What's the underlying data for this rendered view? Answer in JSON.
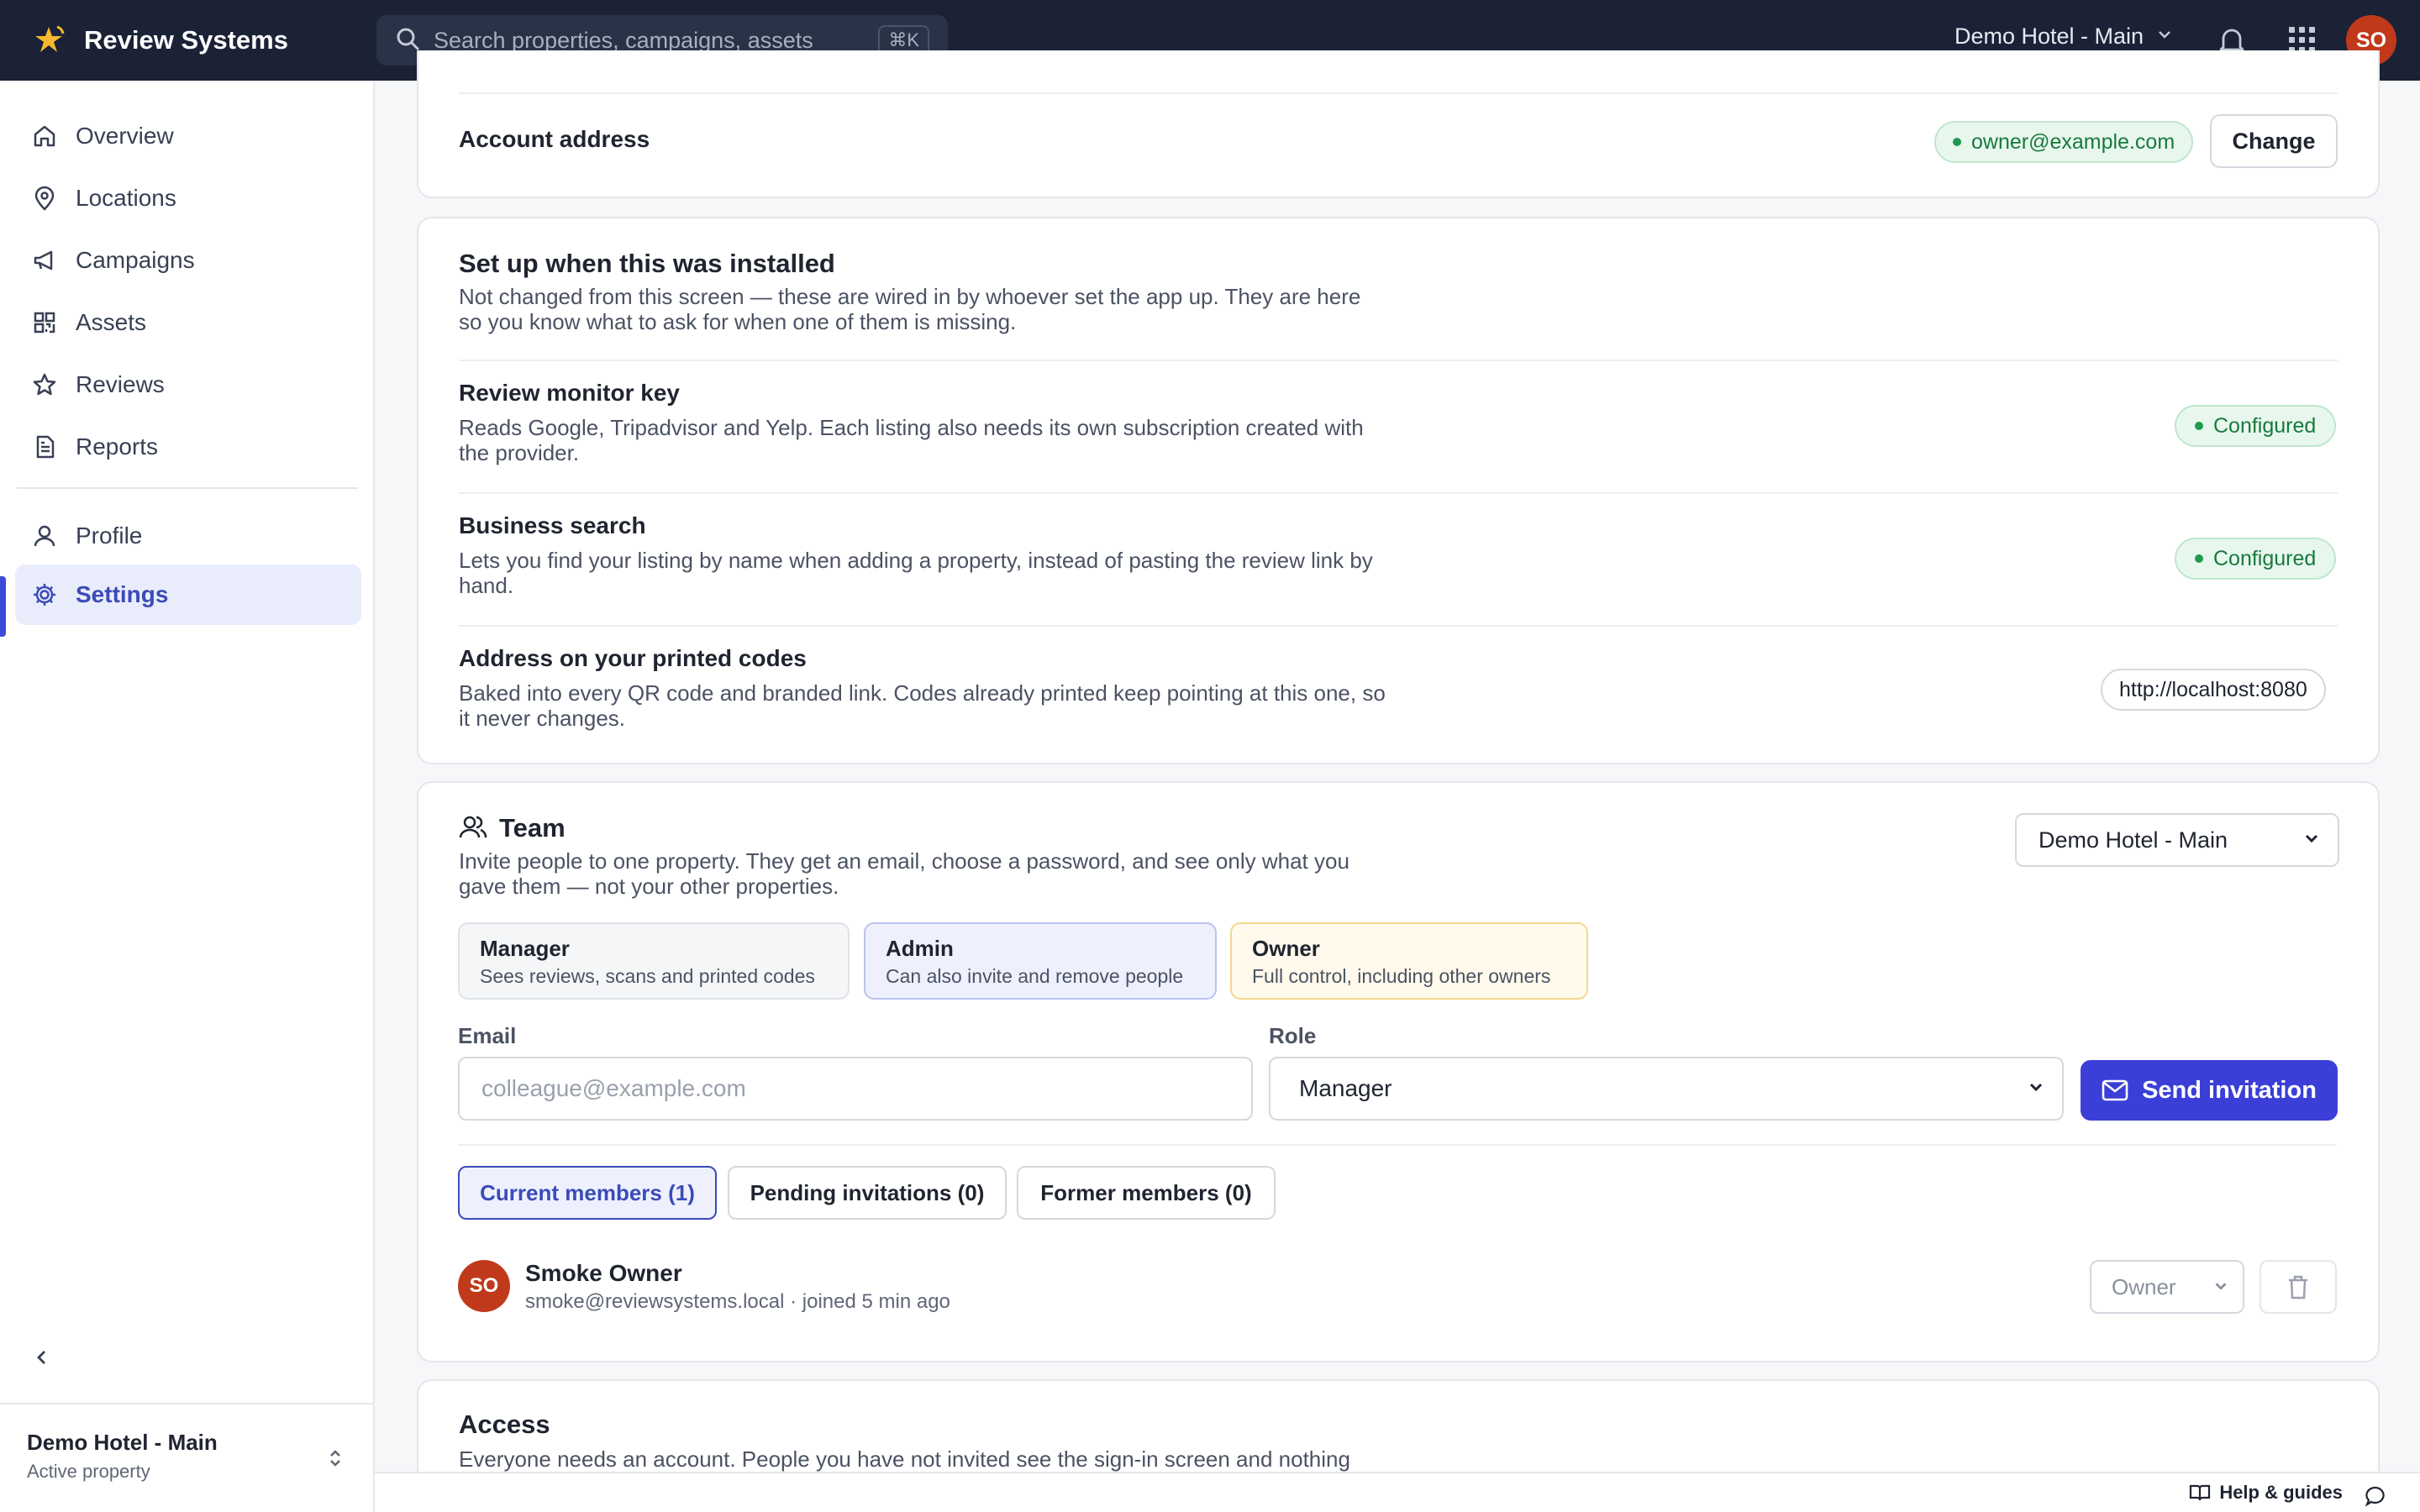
{
  "app": {
    "name": "Review Systems",
    "search_placeholder": "Search properties, campaigns, assets",
    "search_shortcut": "⌘K",
    "property_switcher": "Demo Hotel - Main",
    "user_initials": "SO"
  },
  "sidebar": {
    "items": [
      {
        "label": "Overview"
      },
      {
        "label": "Locations"
      },
      {
        "label": "Campaigns"
      },
      {
        "label": "Assets"
      },
      {
        "label": "Reviews"
      },
      {
        "label": "Reports"
      },
      {
        "label": "Profile"
      },
      {
        "label": "Settings"
      }
    ],
    "footer": {
      "property": "Demo Hotel - Main",
      "status": "Active property"
    }
  },
  "account": {
    "label": "Account address",
    "email": "owner@example.com",
    "change_label": "Change"
  },
  "setup": {
    "title": "Set up when this was installed",
    "desc_line1": "Not changed from this screen — these are wired in by whoever set the app up. They are here",
    "desc_line2": "so you know what to ask for when one of them is missing.",
    "rows": [
      {
        "title": "Review monitor key",
        "desc_line1": "Reads Google, Tripadvisor and Yelp. Each listing also needs its own subscription created with",
        "desc_line2": "the provider.",
        "status": "Configured"
      },
      {
        "title": "Business search",
        "desc_line1": "Lets you find your listing by name when adding a property, instead of pasting the review link by",
        "desc_line2": "hand.",
        "status": "Configured"
      },
      {
        "title": "Address on your printed codes",
        "desc_line1": "Baked into every QR code and branded link. Codes already printed keep pointing at this one, so",
        "desc_line2": "it never changes.",
        "value": "http://localhost:8080"
      }
    ]
  },
  "team": {
    "title": "Team",
    "desc_line1": "Invite people to one property. They get an email, choose a password, and see only what you",
    "desc_line2": "gave them — not your other properties.",
    "property_select": "Demo Hotel - Main",
    "roles": [
      {
        "title": "Manager",
        "desc": "Sees reviews, scans and printed codes"
      },
      {
        "title": "Admin",
        "desc": "Can also invite and remove people"
      },
      {
        "title": "Owner",
        "desc": "Full control, including other owners"
      }
    ],
    "email_label": "Email",
    "email_placeholder": "colleague@example.com",
    "role_label": "Role",
    "role_value": "Manager",
    "send_label": "Send invitation",
    "tabs": [
      {
        "label": "Current members (1)"
      },
      {
        "label": "Pending invitations (0)"
      },
      {
        "label": "Former members (0)"
      }
    ],
    "members": [
      {
        "initials": "SO",
        "name": "Smoke Owner",
        "meta": "smoke@reviewsystems.local · joined 5 min ago",
        "role": "Owner"
      }
    ]
  },
  "access": {
    "title": "Access",
    "desc": "Everyone needs an account. People you have not invited see the sign-in screen and nothing"
  },
  "help": {
    "label": "Help & guides"
  },
  "colors": {
    "topbar": "#1b2236",
    "accent": "#3b3fd8",
    "configured": "#187a3c",
    "avatar": "#c0391b"
  }
}
